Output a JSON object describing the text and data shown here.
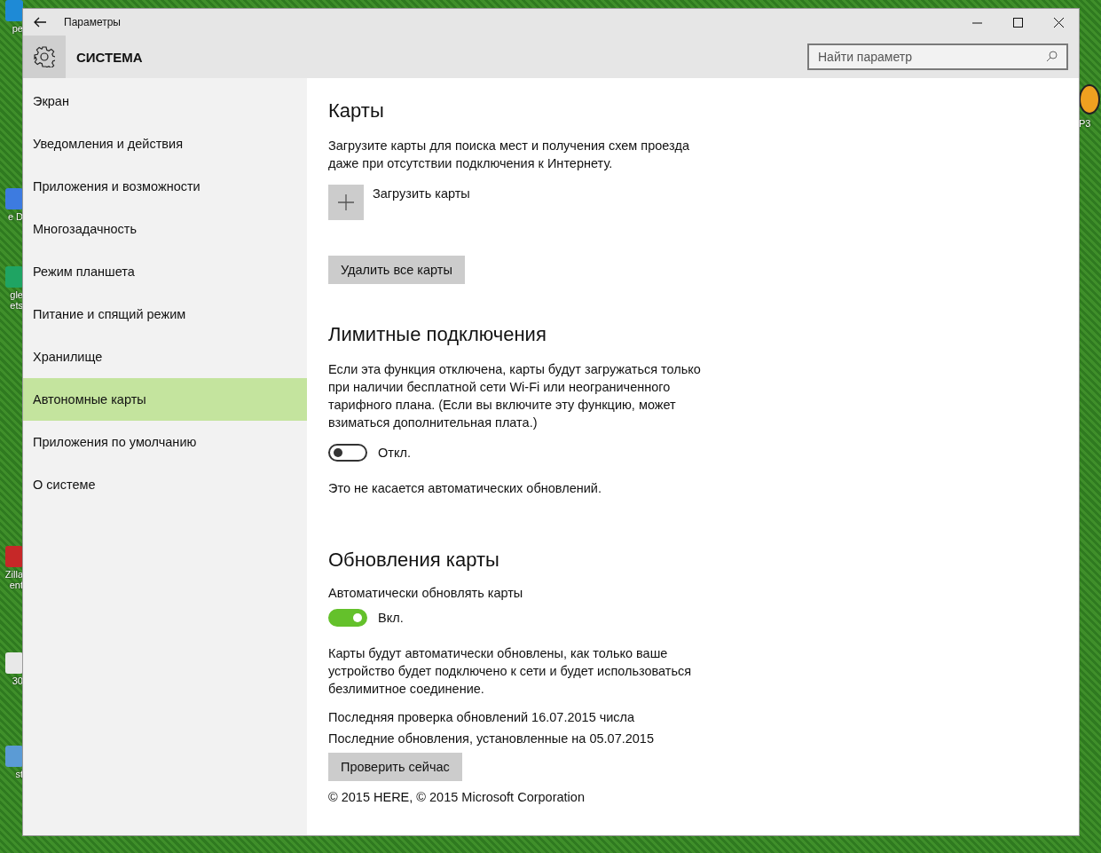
{
  "desktop": {
    "left_icons": [
      {
        "lines": [
          "pe"
        ]
      },
      {
        "lines": [
          "e D"
        ]
      },
      {
        "lines": [
          "gle",
          "ets"
        ]
      },
      {
        "lines": [
          "Zilla",
          "ent"
        ]
      },
      {
        "lines": [
          "30"
        ]
      },
      {
        "lines": [
          "st"
        ]
      }
    ],
    "right_icons": [
      {
        "lines": [
          "P3"
        ]
      }
    ]
  },
  "window": {
    "title": "Параметры"
  },
  "header": {
    "title": "СИСТЕМА",
    "search": {
      "placeholder": "Найти параметр"
    }
  },
  "sidebar": {
    "items": [
      {
        "label": "Экран",
        "selected": false
      },
      {
        "label": "Уведомления и действия",
        "selected": false
      },
      {
        "label": "Приложения и возможности",
        "selected": false
      },
      {
        "label": "Многозадачность",
        "selected": false
      },
      {
        "label": "Режим планшета",
        "selected": false
      },
      {
        "label": "Питание и спящий режим",
        "selected": false
      },
      {
        "label": "Хранилище",
        "selected": false
      },
      {
        "label": "Автономные карты",
        "selected": true
      },
      {
        "label": "Приложения по умолчанию",
        "selected": false
      },
      {
        "label": "О системе",
        "selected": false
      }
    ]
  },
  "content": {
    "sections": [
      {
        "title": "Карты",
        "blocks": [
          {
            "kind": "text",
            "text": "Загрузите карты для поиска мест и получения схем проезда даже при отсутствии подключения к Интернету."
          },
          {
            "kind": "add",
            "text": "Загрузить карты"
          },
          {
            "kind": "button",
            "text": "Удалить все карты"
          }
        ]
      },
      {
        "title": "Лимитные подключения",
        "blocks": [
          {
            "kind": "text",
            "text": "Если эта функция отключена, карты будут загружаться только при наличии бесплатной сети Wi-Fi или неограниченного тарифного плана. (Если вы включите эту функцию, может взиматься дополнительная плата.)"
          },
          {
            "kind": "toggle",
            "on": false,
            "text": "Откл."
          },
          {
            "kind": "text",
            "text": "Это не касается автоматических обновлений."
          }
        ]
      },
      {
        "title": "Обновления карты",
        "blocks": [
          {
            "kind": "label",
            "text": "Автоматически обновлять карты"
          },
          {
            "kind": "toggle",
            "on": true,
            "text": "Вкл."
          },
          {
            "kind": "text",
            "text": "Карты будут автоматически обновлены, как только ваше устройство будет подключено к сети и будет использоваться безлимитное соединение."
          },
          {
            "kind": "info",
            "text": "Последняя проверка обновлений 16.07.2015 числа"
          },
          {
            "kind": "info",
            "text": "Последние обновления, установленные на 05.07.2015"
          },
          {
            "kind": "button",
            "text": "Проверить сейчас"
          },
          {
            "kind": "footer",
            "text": "© 2015 HERE, © 2015 Microsoft Corporation"
          }
        ]
      }
    ]
  }
}
